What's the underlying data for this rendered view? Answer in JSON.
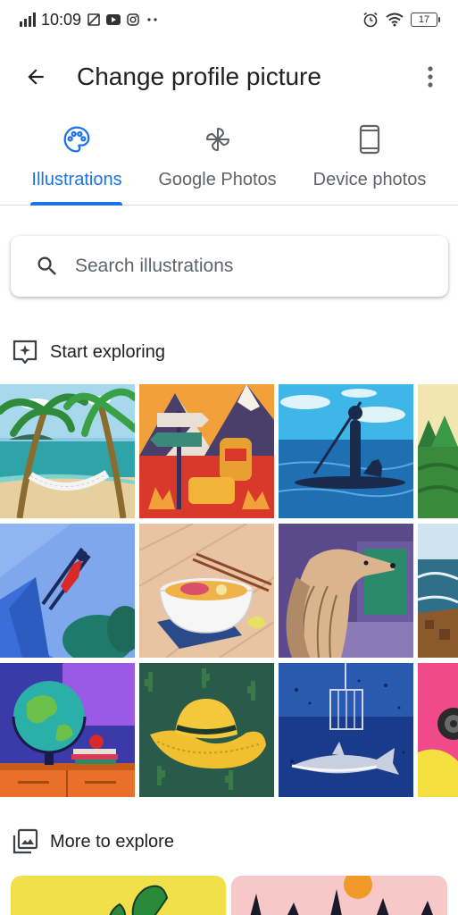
{
  "status_bar": {
    "time": "10:09",
    "battery": "17",
    "icons": [
      "signal-icon",
      "sim-icon",
      "youtube-icon",
      "instagram-icon",
      "more-dots-icon",
      "alarm-icon",
      "wifi-icon",
      "battery-icon"
    ]
  },
  "app_bar": {
    "title": "Change profile picture",
    "back_icon": "arrow-back-icon",
    "more_icon": "more-vert-icon"
  },
  "tabs": [
    {
      "label": "Illustrations",
      "icon": "palette-icon",
      "active": true
    },
    {
      "label": "Google Photos",
      "icon": "pinwheel-icon",
      "active": false
    },
    {
      "label": "Device photos",
      "icon": "phone-icon",
      "active": false
    }
  ],
  "colors": {
    "accent": "#1a73e8",
    "text_primary": "#202124",
    "text_secondary": "#5f6368"
  },
  "search": {
    "placeholder": "Search illustrations",
    "value": ""
  },
  "sections": {
    "start_exploring": "Start exploring",
    "more_to_explore": "More to explore"
  },
  "illustrations": [
    "beach-hammock",
    "mountain-hiking-signpost",
    "paddleboard-dog",
    "green-hills",
    "ski-jumper",
    "noodle-bowl",
    "afghan-hound",
    "coastal-cliffs",
    "globe-desk",
    "cowboy-hat-cactus",
    "shark-cage-diving",
    "pink-abstract"
  ]
}
